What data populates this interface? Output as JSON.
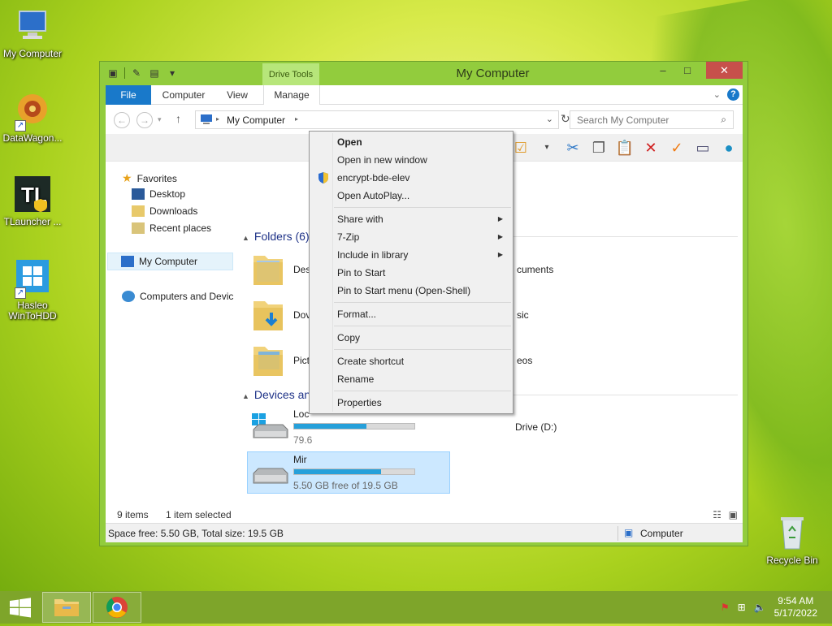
{
  "desktop": {
    "icons": [
      {
        "label": "My Computer",
        "icon": "computer-icon"
      },
      {
        "label": "DataWagon...",
        "icon": "datawagon-icon"
      },
      {
        "label": "TLauncher ...",
        "icon": "tlauncher-icon"
      },
      {
        "label": "Hasleo WinToHDD",
        "icon": "wintohdd-icon"
      },
      {
        "label": "Recycle Bin",
        "icon": "recycle-bin-icon"
      }
    ]
  },
  "window": {
    "title": "My Computer",
    "contextual_tab_group": "Drive Tools",
    "tabs": {
      "file": "File",
      "computer": "Computer",
      "view": "View",
      "manage": "Manage"
    },
    "breadcrumb": "My Computer",
    "search_placeholder": "Search My Computer"
  },
  "nav": {
    "favorites": "Favorites",
    "desktop": "Desktop",
    "downloads": "Downloads",
    "recent": "Recent places",
    "my_computer": "My Computer",
    "network": "Computers and Devic"
  },
  "main": {
    "folders_header": "Folders (6)",
    "devices_header": "Devices an",
    "folders": [
      {
        "label": "Des"
      },
      {
        "label": "cuments"
      },
      {
        "label": "Dov"
      },
      {
        "label": "sic"
      },
      {
        "label": "Pict"
      },
      {
        "label": "eos"
      }
    ],
    "drives": [
      {
        "label": "Loc",
        "free_text": "79.6",
        "usage_fraction": 0.6
      },
      {
        "label": "Drive (D:)"
      },
      {
        "label": "Mir",
        "free_text": "5.50 GB free of 19.5 GB",
        "usage_fraction": 0.72
      }
    ]
  },
  "status": {
    "items": "9 items",
    "selected": "1 item selected",
    "space": "Space free: 5.50 GB, Total size: 19.5 GB",
    "location": "Computer"
  },
  "context_menu": {
    "items": [
      "Open",
      "Open in new window",
      "encrypt-bde-elev",
      "Open AutoPlay...",
      "Share with",
      "7-Zip",
      "Include in library",
      "Pin to Start",
      "Pin to Start menu (Open-Shell)",
      "Format...",
      "Copy",
      "Create shortcut",
      "Rename",
      "Properties"
    ]
  },
  "taskbar": {
    "time": "9:54 AM",
    "date": "5/17/2022"
  },
  "colors": {
    "accent": "#1979ca",
    "window_frame": "#92cc3d",
    "taskbar": "#7ea52a",
    "close": "#c7504b"
  }
}
